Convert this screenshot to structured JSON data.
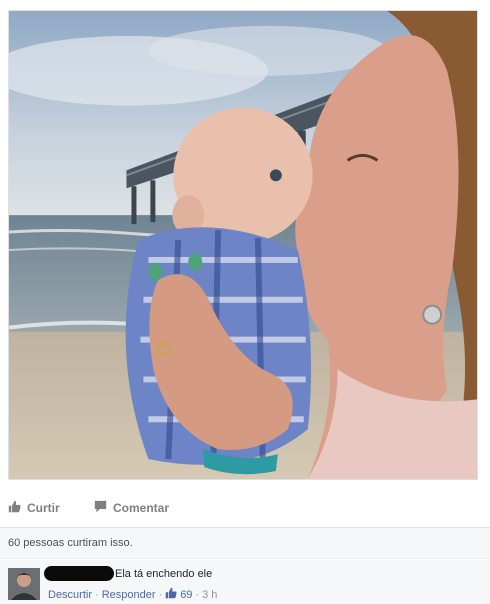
{
  "actions": {
    "like_label": "Curtir",
    "comment_label": "Comentar",
    "like_icon": "thumbs-up-icon",
    "comment_icon": "comment-bubble-icon"
  },
  "summary": {
    "likes_text": "60 pessoas curtiram isso."
  },
  "comment": {
    "text": "Ela tá enchendo ele",
    "unlike_label": "Descurtir",
    "reply_label": "Responder",
    "like_count": "69",
    "time": "3 h",
    "separator": "·"
  },
  "colors": {
    "link": "#4e69a2",
    "muted": "#90949c",
    "action_gray": "#7f7f7f",
    "summary_bg": "#f6f7f9"
  }
}
